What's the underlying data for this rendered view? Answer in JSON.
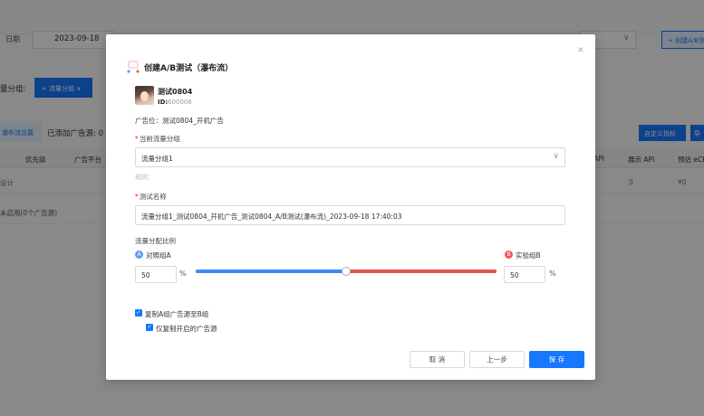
{
  "background": {
    "date_label": "日期",
    "date_value": "2023-09-18",
    "create_button": "+ 创建A/B测",
    "group_label": "量分组:",
    "group_button": "+ 流量分组 ∨",
    "waterfall_button": "瀑布流设置",
    "added_sources": "已添加广告源: 0",
    "custom_metric_button": "自定义指标",
    "export_button": "导",
    "table_headers": [
      "优先级",
      "广告平台",
      "API",
      "展示 API",
      "预估 eCP"
    ],
    "row1_cells": [
      "设计",
      "0",
      "¥0"
    ],
    "row2_text": "未启用(0个广告源)"
  },
  "modal": {
    "title": "创建A/B测试（瀑布流）",
    "app_name": "测试0804",
    "app_id_label": "ID:",
    "app_id_value": "600008",
    "ad_position": "广告位：测试0804_开机广告",
    "current_group_label": "当前流量分组",
    "current_group_value": "流量分组1",
    "rule_hint": "规则：",
    "test_name_label": "测试名称",
    "test_name_value": "流量分组1_测试0804_开机广告_测试0804_A/B测试(瀑布流)_2023-09-18 17:40:03",
    "ratio_label": "流量分配比例",
    "group_a_letter": "A",
    "group_a_label": "对照组A",
    "group_b_letter": "B",
    "group_b_label": "实验组B",
    "group_a_value": "50",
    "group_b_value": "50",
    "percent": "%",
    "split_fraction": 0.5,
    "copy_a_to_b": "复制A组广告源至B组",
    "copy_enabled_only": "仅复制开启的广告源",
    "cancel": "取 消",
    "prev": "上一步",
    "save": "保 存",
    "close_icon": "×",
    "chevron_icon": "∨",
    "check_icon": "✓"
  },
  "colors": {
    "primary": "#1677ff",
    "group_a": "#3e8af7",
    "group_b": "#e05552"
  }
}
